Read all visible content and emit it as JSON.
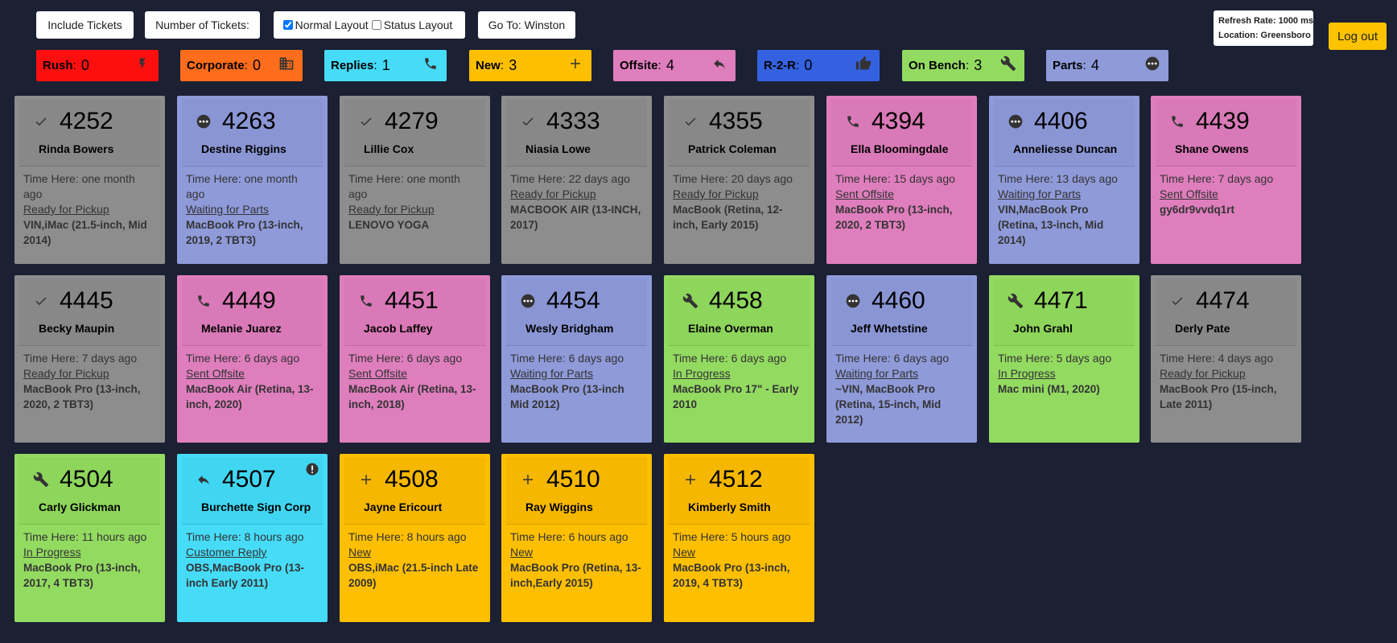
{
  "toolbar": {
    "include_tickets": "Include Tickets",
    "number_of_tickets": "Number of Tickets:",
    "normal_layout": "Normal Layout",
    "normal_layout_checked": true,
    "status_layout": "Status Layout",
    "status_layout_checked": false,
    "go_to": "Go To: Winston"
  },
  "info": {
    "refresh": "Refresh Rate: 1000 ms",
    "location": "Location: Greensboro"
  },
  "logout": "Log out",
  "stats": [
    {
      "label": "Rush",
      "count": "0",
      "icon": "bolt-icon",
      "color": "#fe0f0f"
    },
    {
      "label": "Corporate",
      "count": "0",
      "icon": "building-icon",
      "color": "#fd6d1b"
    },
    {
      "label": "Replies",
      "count": "1",
      "icon": "phone-icon",
      "color": "#46dcf8"
    },
    {
      "label": "New",
      "count": "3",
      "icon": "plus-icon",
      "color": "#fdbf00"
    },
    {
      "label": "Offsite",
      "count": "4",
      "icon": "reply-icon",
      "color": "#df7ebd"
    },
    {
      "label": "R-2-R",
      "count": "0",
      "icon": "thumbs-up-icon",
      "color": "#3461e0"
    },
    {
      "label": "On Bench",
      "count": "3",
      "icon": "wrench-icon",
      "color": "#93da61"
    },
    {
      "label": "Parts",
      "count": "4",
      "icon": "more-icon",
      "color": "#8f9ad9"
    }
  ],
  "tickets": [
    {
      "num": "4252",
      "name": "Rinda Bowers",
      "time": "Time Here: one month ago",
      "status": "Ready for Pickup",
      "device": "VIN,iMac (21.5-inch, Mid 2014)",
      "icon": "check-icon",
      "color": "gray"
    },
    {
      "num": "4263",
      "name": "Destine Riggins",
      "time": "Time Here: one month ago",
      "status": "Waiting for Parts",
      "device": "MacBook Pro (13-inch, 2019, 2 TBT3)",
      "icon": "more-icon",
      "color": "purple"
    },
    {
      "num": "4279",
      "name": "Lillie Cox",
      "time": "Time Here: one month ago",
      "status": "Ready for Pickup",
      "device": "LENOVO YOGA",
      "icon": "check-icon",
      "color": "gray"
    },
    {
      "num": "4333",
      "name": "Niasia Lowe",
      "time": "Time Here: 22 days ago",
      "status": "Ready for Pickup",
      "device": "MACBOOK AIR (13-INCH, 2017)",
      "icon": "check-icon",
      "color": "gray"
    },
    {
      "num": "4355",
      "name": "Patrick Coleman",
      "time": "Time Here: 20 days ago",
      "status": "Ready for Pickup",
      "device": "MacBook (Retina, 12-inch, Early 2015)",
      "icon": "check-icon",
      "color": "gray"
    },
    {
      "num": "4394",
      "name": "Ella Bloomingdale",
      "time": "Time Here: 15 days ago",
      "status": "Sent Offsite",
      "device": "MacBook Pro (13-inch, 2020, 2 TBT3)",
      "icon": "phone-icon",
      "color": "pink"
    },
    {
      "num": "4406",
      "name": "Anneliesse Duncan",
      "time": "Time Here: 13 days ago",
      "status": "Waiting for Parts",
      "device": "VIN,MacBook Pro (Retina, 13-inch, Mid 2014)",
      "icon": "more-icon",
      "color": "purple"
    },
    {
      "num": "4439",
      "name": "Shane Owens",
      "time": "Time Here: 7 days ago",
      "status": "Sent Offsite",
      "device": "gy6dr9vvdq1rt",
      "icon": "phone-icon",
      "color": "pink"
    },
    {
      "num": "4445",
      "name": "Becky Maupin",
      "time": "Time Here: 7 days ago",
      "status": "Ready for Pickup",
      "device": "MacBook Pro (13-inch, 2020, 2 TBT3)",
      "icon": "check-icon",
      "color": "gray"
    },
    {
      "num": "4449",
      "name": "Melanie Juarez",
      "time": "Time Here: 6 days ago",
      "status": "Sent Offsite",
      "device": "MacBook Air (Retina, 13-inch, 2020)",
      "icon": "phone-icon",
      "color": "pink"
    },
    {
      "num": "4451",
      "name": "Jacob Laffey",
      "time": "Time Here: 6 days ago",
      "status": "Sent Offsite",
      "device": "MacBook Air (Retina, 13-inch, 2018)",
      "icon": "phone-icon",
      "color": "pink"
    },
    {
      "num": "4454",
      "name": "Wesly Bridgham",
      "time": "Time Here: 6 days ago",
      "status": "Waiting for Parts",
      "device": "MacBook Pro (13-inch Mid 2012)",
      "icon": "more-icon",
      "color": "purple"
    },
    {
      "num": "4458",
      "name": "Elaine Overman",
      "time": "Time Here: 6 days ago",
      "status": "In Progress",
      "device": "MacBook Pro 17\" - Early 2010",
      "icon": "wrench-icon",
      "color": "green"
    },
    {
      "num": "4460",
      "name": "Jeff Whetstine",
      "time": "Time Here: 6 days ago",
      "status": "Waiting for Parts",
      "device": "~VIN, MacBook Pro (Retina, 15-inch, Mid 2012)",
      "icon": "more-icon",
      "color": "purple"
    },
    {
      "num": "4471",
      "name": "John Grahl",
      "time": "Time Here: 5 days ago",
      "status": "In Progress",
      "device": "Mac mini (M1, 2020)",
      "icon": "wrench-icon",
      "color": "green"
    },
    {
      "num": "4474",
      "name": "Derly Pate",
      "time": "Time Here: 4 days ago",
      "status": "Ready for Pickup",
      "device": "MacBook Pro (15-inch, Late 2011)",
      "icon": "check-icon",
      "color": "gray"
    },
    {
      "num": "4504",
      "name": "Carly Glickman",
      "time": "Time Here: 11 hours ago",
      "status": "In Progress",
      "device": "MacBook Pro (13-inch, 2017, 4 TBT3)",
      "icon": "wrench-icon",
      "color": "green"
    },
    {
      "num": "4507",
      "name": "Burchette Sign Corp",
      "time": "Time Here: 8 hours ago",
      "status": "Customer Reply",
      "device": "OBS,MacBook Pro (13-inch Early 2011)",
      "icon": "reply-icon",
      "color": "cyan",
      "alert": true
    },
    {
      "num": "4508",
      "name": "Jayne Ericourt",
      "time": "Time Here: 8 hours ago",
      "status": "New",
      "device": "OBS,iMac (21.5-inch Late 2009)",
      "icon": "plus-icon",
      "color": "yellow"
    },
    {
      "num": "4510",
      "name": "Ray Wiggins",
      "time": "Time Here: 6 hours ago",
      "status": "New",
      "device": "MacBook Pro (Retina, 13-inch,Early 2015)",
      "icon": "plus-icon",
      "color": "yellow"
    },
    {
      "num": "4512",
      "name": "Kimberly Smith",
      "time": "Time Here: 5 hours ago",
      "status": "New",
      "device": "MacBook Pro (13-inch, 2019, 4 TBT3)",
      "icon": "plus-icon",
      "color": "yellow"
    }
  ]
}
